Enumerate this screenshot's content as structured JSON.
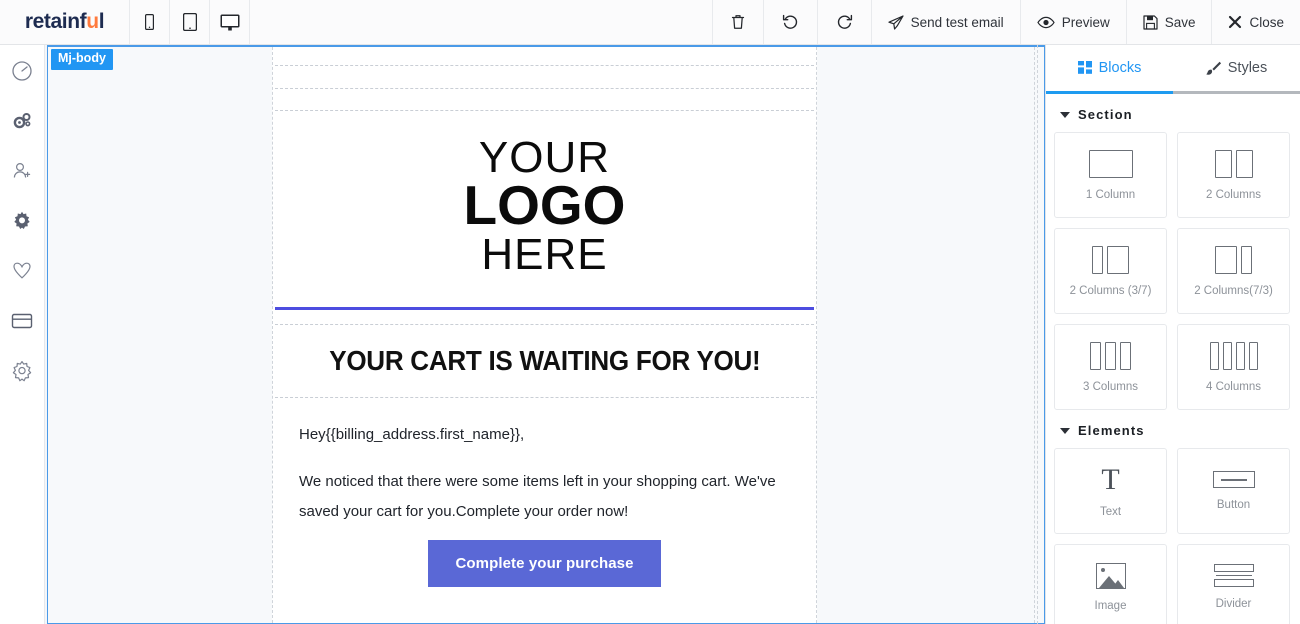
{
  "brand": {
    "part1": "retainf",
    "part2": "u",
    "part3": "l"
  },
  "topbar": {
    "devices": [
      {
        "name": "mobile-view-button",
        "label": "Mobile"
      },
      {
        "name": "tablet-view-button",
        "label": "Tablet"
      },
      {
        "name": "desktop-view-button",
        "label": "Desktop"
      }
    ],
    "delete_label": "",
    "undo_label": "",
    "redo_label": "",
    "send_test_email": "Send test email",
    "preview": "Preview",
    "save": "Save",
    "close": "Close"
  },
  "sidebar": {
    "items": [
      {
        "icon": "dashboard-icon"
      },
      {
        "icon": "cogs-icon"
      },
      {
        "icon": "user-add-icon"
      },
      {
        "icon": "gear-icon"
      },
      {
        "icon": "tag-icon"
      },
      {
        "icon": "credit-card-icon"
      },
      {
        "icon": "settings-gear-icon"
      }
    ]
  },
  "canvas": {
    "body_badge": "Mj-body",
    "logo": {
      "line1": "YOUR",
      "line2": "LOGO",
      "line3": "HERE"
    },
    "divider_color": "#4d4de0",
    "headline": "YOUR CART IS WAITING FOR YOU!",
    "greeting": "Hey{{billing_address.first_name}},",
    "paragraph": "We noticed that there were some items left in your shopping cart. We've saved your cart for you.Complete your order now!",
    "cta_label": "Complete your purchase",
    "cta_color": "#5a68d6"
  },
  "right_panel": {
    "tabs": [
      {
        "label": "Blocks",
        "active": true
      },
      {
        "label": "Styles",
        "active": false
      }
    ],
    "groups": [
      {
        "title": "Section",
        "items": [
          {
            "label": "1 Column",
            "glyph": "one-column"
          },
          {
            "label": "2 Columns",
            "glyph": "two-columns"
          },
          {
            "label": "2 Columns (3/7)",
            "glyph": "two-columns-3-7"
          },
          {
            "label": "2 Columns(7/3)",
            "glyph": "two-columns-7-3"
          },
          {
            "label": "3 Columns",
            "glyph": "three-columns"
          },
          {
            "label": "4 Columns",
            "glyph": "four-columns"
          }
        ]
      },
      {
        "title": "Elements",
        "items": [
          {
            "label": "Text",
            "glyph": "text"
          },
          {
            "label": "Button",
            "glyph": "button"
          },
          {
            "label": "Image",
            "glyph": "image"
          },
          {
            "label": "Divider",
            "glyph": "divider"
          }
        ]
      }
    ]
  }
}
